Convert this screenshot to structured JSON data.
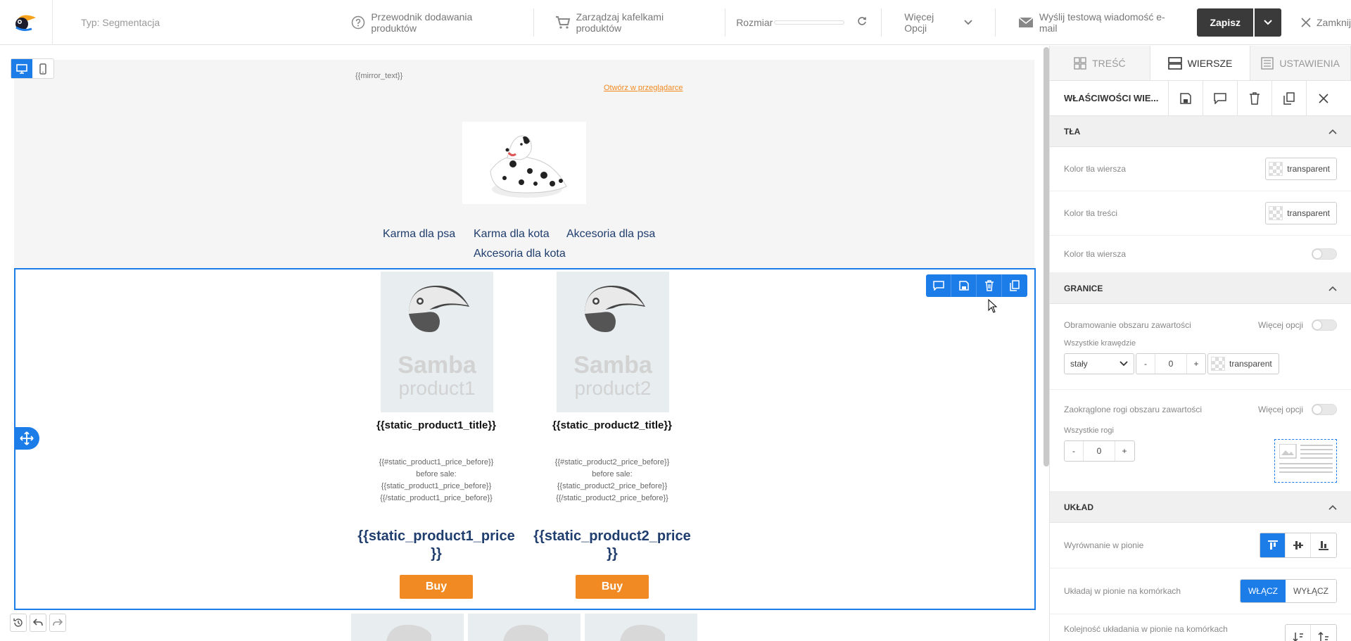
{
  "topbar": {
    "segment_type": "Typ: Segmentacja",
    "guide": "Przewodnik dodawania produktów",
    "manage_tiles": "Zarządzaj kafelkami produktów",
    "size_label": "Rozmiar",
    "more_options": "Więcej Opcji",
    "send_test": "Wyślij testową wiadomość e-mail",
    "save": "Zapisz",
    "close": "Zamknij"
  },
  "email": {
    "mirror_text": "{{mirror_text}}",
    "open_in_browser": "Otwórz w przeglądarce",
    "nav": [
      "Karma dla psa",
      "Karma dla kota",
      "Akcesoria dla psa",
      "Akcesoria dla kota"
    ],
    "products": [
      {
        "brand": "Samba",
        "name": "product1",
        "title": "{{static_product1_title}}",
        "desc": [
          "{{#static_product1_price_before}}",
          "before sale:",
          "{{static_product1_price_before}}",
          "{{/static_product1_price_before}}"
        ],
        "price_line1": "{{static_product1_price",
        "price_line2": "}}",
        "buy": "Buy"
      },
      {
        "brand": "Samba",
        "name": "product2",
        "title": "{{static_product2_title}}",
        "desc": [
          "{{#static_product2_price_before}}",
          "before sale:",
          "{{static_product2_price_before}}",
          "{{/static_product2_price_before}}"
        ],
        "price_line1": "{{static_product2_price",
        "price_line2": "}}",
        "buy": "Buy"
      }
    ]
  },
  "panel": {
    "tabs": [
      "TREŚĆ",
      "WIERSZE",
      "USTAWIENIA"
    ],
    "props_title": "WŁAŚCIWOŚCI WIE...",
    "backgrounds": {
      "header": "TŁA",
      "row_bg": "Kolor tła wiersza",
      "content_bg": "Kolor tła treści",
      "row_bg2": "Kolor tła wiersza",
      "transparent": "transparent"
    },
    "borders": {
      "header": "GRANICE",
      "content_border": "Obramowanie obszaru zawartości",
      "more_options": "Więcej opcji",
      "all_edges": "Wszystkie krawędzie",
      "style_value": "stały",
      "width_value": "0",
      "minus": "-",
      "plus": "+",
      "rounded": "Zaokrąglone rogi obszaru zawartości",
      "all_corners": "Wszystkie rogi",
      "radius_value": "0"
    },
    "layout": {
      "header": "UKŁAD",
      "vertical_align": "Wyrównanie w pionie",
      "stack_mobile": "Układaj w pionie na komórkach",
      "on": "WŁĄCZ",
      "off": "WYŁĄCZ",
      "stack_order": "Kolejność układania w pionie na komórkach"
    }
  },
  "colors": {
    "accent": "#1d7de8",
    "buy": "#f28a23",
    "nav_text": "#1f3d6d",
    "save_bg": "#3a3a3a"
  }
}
